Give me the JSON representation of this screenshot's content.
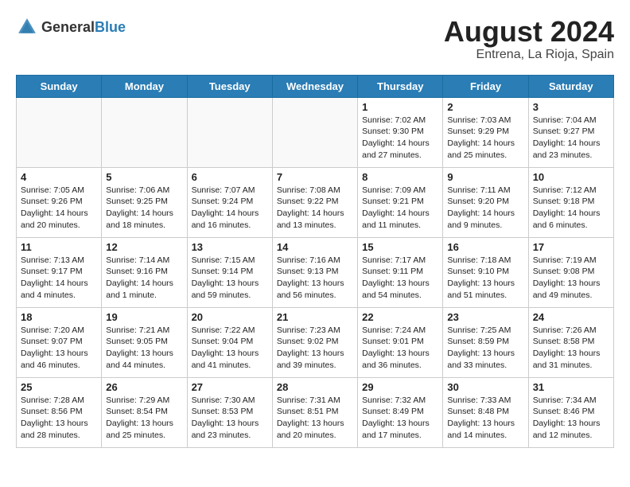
{
  "header": {
    "logo_general": "General",
    "logo_blue": "Blue",
    "month_year": "August 2024",
    "location": "Entrena, La Rioja, Spain"
  },
  "days_of_week": [
    "Sunday",
    "Monday",
    "Tuesday",
    "Wednesday",
    "Thursday",
    "Friday",
    "Saturday"
  ],
  "weeks": [
    [
      {
        "date": "",
        "info": "",
        "empty": true
      },
      {
        "date": "",
        "info": "",
        "empty": true
      },
      {
        "date": "",
        "info": "",
        "empty": true
      },
      {
        "date": "",
        "info": "",
        "empty": true
      },
      {
        "date": "1",
        "info": "Sunrise: 7:02 AM\nSunset: 9:30 PM\nDaylight: 14 hours\nand 27 minutes.",
        "empty": false
      },
      {
        "date": "2",
        "info": "Sunrise: 7:03 AM\nSunset: 9:29 PM\nDaylight: 14 hours\nand 25 minutes.",
        "empty": false
      },
      {
        "date": "3",
        "info": "Sunrise: 7:04 AM\nSunset: 9:27 PM\nDaylight: 14 hours\nand 23 minutes.",
        "empty": false
      }
    ],
    [
      {
        "date": "4",
        "info": "Sunrise: 7:05 AM\nSunset: 9:26 PM\nDaylight: 14 hours\nand 20 minutes.",
        "empty": false
      },
      {
        "date": "5",
        "info": "Sunrise: 7:06 AM\nSunset: 9:25 PM\nDaylight: 14 hours\nand 18 minutes.",
        "empty": false
      },
      {
        "date": "6",
        "info": "Sunrise: 7:07 AM\nSunset: 9:24 PM\nDaylight: 14 hours\nand 16 minutes.",
        "empty": false
      },
      {
        "date": "7",
        "info": "Sunrise: 7:08 AM\nSunset: 9:22 PM\nDaylight: 14 hours\nand 13 minutes.",
        "empty": false
      },
      {
        "date": "8",
        "info": "Sunrise: 7:09 AM\nSunset: 9:21 PM\nDaylight: 14 hours\nand 11 minutes.",
        "empty": false
      },
      {
        "date": "9",
        "info": "Sunrise: 7:11 AM\nSunset: 9:20 PM\nDaylight: 14 hours\nand 9 minutes.",
        "empty": false
      },
      {
        "date": "10",
        "info": "Sunrise: 7:12 AM\nSunset: 9:18 PM\nDaylight: 14 hours\nand 6 minutes.",
        "empty": false
      }
    ],
    [
      {
        "date": "11",
        "info": "Sunrise: 7:13 AM\nSunset: 9:17 PM\nDaylight: 14 hours\nand 4 minutes.",
        "empty": false
      },
      {
        "date": "12",
        "info": "Sunrise: 7:14 AM\nSunset: 9:16 PM\nDaylight: 14 hours\nand 1 minute.",
        "empty": false
      },
      {
        "date": "13",
        "info": "Sunrise: 7:15 AM\nSunset: 9:14 PM\nDaylight: 13 hours\nand 59 minutes.",
        "empty": false
      },
      {
        "date": "14",
        "info": "Sunrise: 7:16 AM\nSunset: 9:13 PM\nDaylight: 13 hours\nand 56 minutes.",
        "empty": false
      },
      {
        "date": "15",
        "info": "Sunrise: 7:17 AM\nSunset: 9:11 PM\nDaylight: 13 hours\nand 54 minutes.",
        "empty": false
      },
      {
        "date": "16",
        "info": "Sunrise: 7:18 AM\nSunset: 9:10 PM\nDaylight: 13 hours\nand 51 minutes.",
        "empty": false
      },
      {
        "date": "17",
        "info": "Sunrise: 7:19 AM\nSunset: 9:08 PM\nDaylight: 13 hours\nand 49 minutes.",
        "empty": false
      }
    ],
    [
      {
        "date": "18",
        "info": "Sunrise: 7:20 AM\nSunset: 9:07 PM\nDaylight: 13 hours\nand 46 minutes.",
        "empty": false
      },
      {
        "date": "19",
        "info": "Sunrise: 7:21 AM\nSunset: 9:05 PM\nDaylight: 13 hours\nand 44 minutes.",
        "empty": false
      },
      {
        "date": "20",
        "info": "Sunrise: 7:22 AM\nSunset: 9:04 PM\nDaylight: 13 hours\nand 41 minutes.",
        "empty": false
      },
      {
        "date": "21",
        "info": "Sunrise: 7:23 AM\nSunset: 9:02 PM\nDaylight: 13 hours\nand 39 minutes.",
        "empty": false
      },
      {
        "date": "22",
        "info": "Sunrise: 7:24 AM\nSunset: 9:01 PM\nDaylight: 13 hours\nand 36 minutes.",
        "empty": false
      },
      {
        "date": "23",
        "info": "Sunrise: 7:25 AM\nSunset: 8:59 PM\nDaylight: 13 hours\nand 33 minutes.",
        "empty": false
      },
      {
        "date": "24",
        "info": "Sunrise: 7:26 AM\nSunset: 8:58 PM\nDaylight: 13 hours\nand 31 minutes.",
        "empty": false
      }
    ],
    [
      {
        "date": "25",
        "info": "Sunrise: 7:28 AM\nSunset: 8:56 PM\nDaylight: 13 hours\nand 28 minutes.",
        "empty": false
      },
      {
        "date": "26",
        "info": "Sunrise: 7:29 AM\nSunset: 8:54 PM\nDaylight: 13 hours\nand 25 minutes.",
        "empty": false
      },
      {
        "date": "27",
        "info": "Sunrise: 7:30 AM\nSunset: 8:53 PM\nDaylight: 13 hours\nand 23 minutes.",
        "empty": false
      },
      {
        "date": "28",
        "info": "Sunrise: 7:31 AM\nSunset: 8:51 PM\nDaylight: 13 hours\nand 20 minutes.",
        "empty": false
      },
      {
        "date": "29",
        "info": "Sunrise: 7:32 AM\nSunset: 8:49 PM\nDaylight: 13 hours\nand 17 minutes.",
        "empty": false
      },
      {
        "date": "30",
        "info": "Sunrise: 7:33 AM\nSunset: 8:48 PM\nDaylight: 13 hours\nand 14 minutes.",
        "empty": false
      },
      {
        "date": "31",
        "info": "Sunrise: 7:34 AM\nSunset: 8:46 PM\nDaylight: 13 hours\nand 12 minutes.",
        "empty": false
      }
    ]
  ]
}
